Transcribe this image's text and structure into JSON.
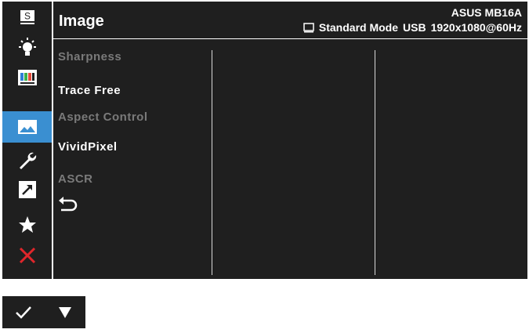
{
  "header": {
    "title": "Image",
    "model": "ASUS MB16A",
    "mode": "Standard Mode",
    "input": "USB",
    "resolution": "1920x1080@60Hz"
  },
  "sidebar": {
    "items": [
      {
        "name": "splendid",
        "icon": "s-letter-icon",
        "label": "S",
        "active": false
      },
      {
        "name": "blue-light-filter",
        "icon": "light-bulb-icon",
        "active": false
      },
      {
        "name": "color",
        "icon": "color-bars-icon",
        "active": false
      },
      {
        "name": "image",
        "icon": "image-icon",
        "active": true
      },
      {
        "name": "system-setup",
        "icon": "wrench-icon",
        "active": false
      },
      {
        "name": "shortcut",
        "icon": "shortcut-arrow-icon",
        "active": false
      },
      {
        "name": "myfavorite",
        "icon": "star-icon",
        "active": false
      },
      {
        "name": "exit",
        "icon": "close-icon",
        "active": false
      }
    ]
  },
  "menu": {
    "items": [
      {
        "label": "Sharpness",
        "enabled": false
      },
      {
        "label": "Trace Free",
        "enabled": true
      },
      {
        "label": "Aspect Control",
        "enabled": false
      },
      {
        "label": "VividPixel",
        "enabled": true
      },
      {
        "label": "ASCR",
        "enabled": false
      }
    ],
    "back_icon": "return-arrow-icon"
  },
  "keys": [
    {
      "name": "confirm",
      "icon": "checkmark-icon"
    },
    {
      "name": "down",
      "icon": "triangle-down-icon"
    }
  ],
  "colors": {
    "osd_background": "#1f1f1f",
    "active_tab": "#3a8fd1",
    "enabled_text": "#ffffff",
    "disabled_text": "#7a7a7a",
    "exit_red": "#e0262b"
  }
}
